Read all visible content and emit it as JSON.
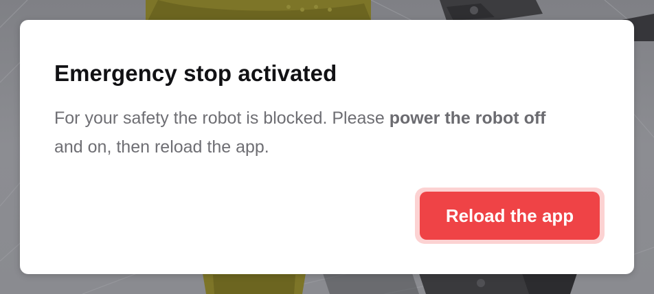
{
  "modal": {
    "title": "Emergency stop activated",
    "body": {
      "before": "For your safety the robot is blocked. Please ",
      "bold": "power the robot off",
      "after": " and on, then reload the app."
    },
    "reload_button_label": "Reload the app"
  },
  "colors": {
    "accent_button": "#ef4346",
    "button_focus_ring": "#fcd2d2",
    "title_text": "#111114",
    "body_text": "#6e6e73",
    "backdrop": "#8a8b90"
  }
}
